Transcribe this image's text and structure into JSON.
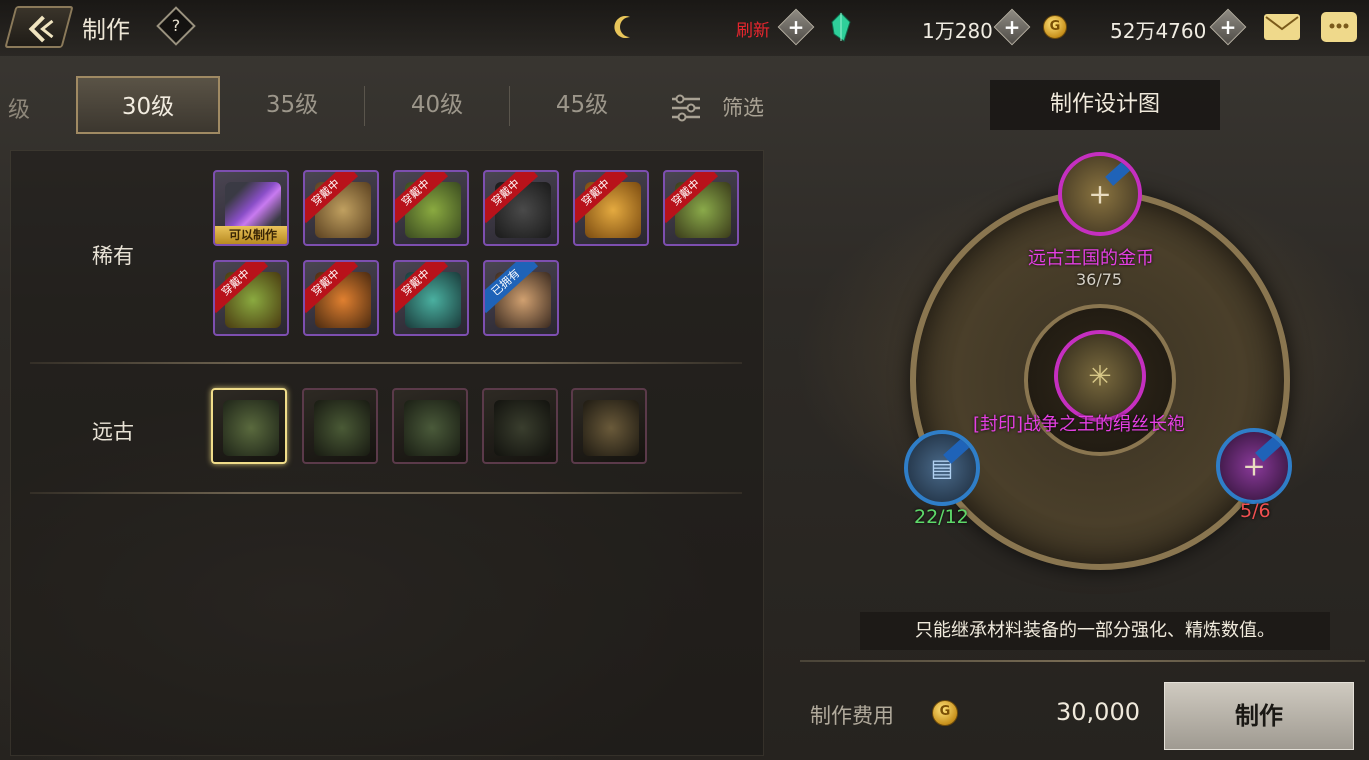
{
  "header": {
    "title": "制作",
    "help_label": "?",
    "refresh_label": "刷新",
    "currency_1": "1万280",
    "currency_2": "52万4760",
    "coin_symbol": "G"
  },
  "tabs": {
    "partial": "级",
    "items": [
      {
        "label": "30级",
        "active": true
      },
      {
        "label": "35级",
        "active": false
      },
      {
        "label": "40级",
        "active": false
      },
      {
        "label": "45级",
        "active": false
      }
    ],
    "filter_label": "筛选"
  },
  "list": {
    "rare_label": "稀有",
    "ancient_label": "远古",
    "craftable_badge": "可以制作",
    "wearing_ribbon": "穿戴中",
    "owned_ribbon": "已拥有",
    "rare_colors": [
      "#8a4fc8",
      "#c0a060",
      "#6a8a40",
      "#3a3a3a",
      "#d49a30",
      "#7a9a40",
      "#6a8a40",
      "#c07028",
      "#3a9a8a",
      "#b08050"
    ],
    "ancient_colors": [
      "#3e4a30",
      "#2e3a26",
      "#3a4a30",
      "#2a2e22",
      "#5a4a30"
    ]
  },
  "design": {
    "title": "制作设计图",
    "top_material_name": "远古王国的金币",
    "top_material_count": "36/75",
    "center_item_name": "[封印]战争之王的绢丝长袍",
    "left_material_count": "22/12",
    "right_material_count": "5/6",
    "note": "只能继承材料装备的一部分强化、精炼数值。",
    "cost_label": "制作费用",
    "cost_value": "30,000",
    "craft_button": "制作"
  },
  "colors": {
    "accent_gold": "#a08a63",
    "rare_purple": "#7d4fb0",
    "epic_magenta": "#c52fc0",
    "refresh_red": "#e8262e"
  }
}
